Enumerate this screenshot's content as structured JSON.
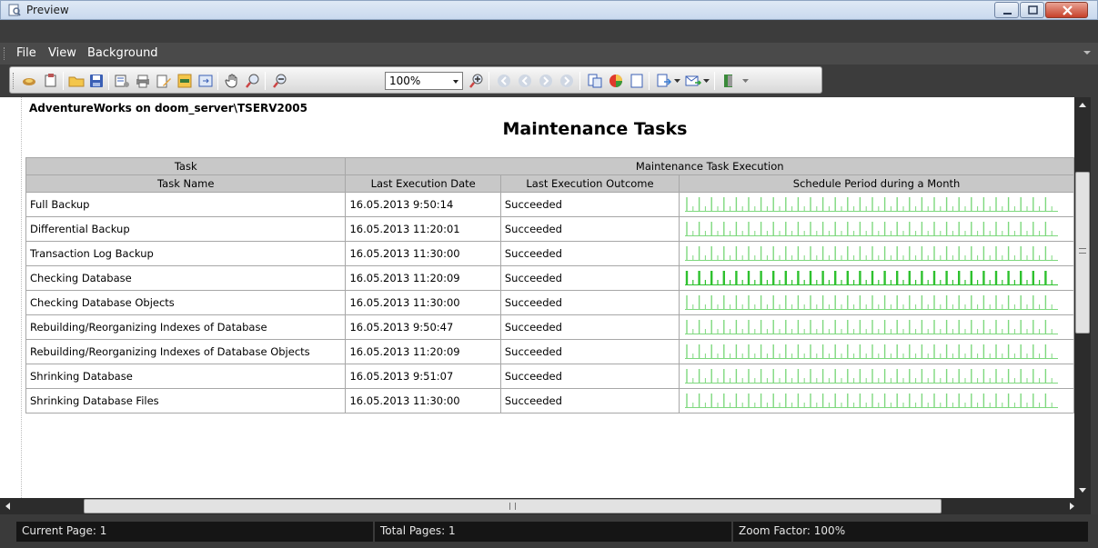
{
  "window": {
    "title": "Preview"
  },
  "menu": {
    "file": "File",
    "view": "View",
    "background": "Background"
  },
  "toolbar": {
    "zoom_value": "100%"
  },
  "report": {
    "server": "AdventureWorks on doom_server\\TSERV2005",
    "title": "Maintenance Tasks",
    "group_headers": {
      "task": "Task",
      "execution": "Maintenance Task Execution"
    },
    "columns": {
      "task_name": "Task Name",
      "last_date": "Last Execution Date",
      "last_outcome": "Last Execution Outcome",
      "schedule": "Schedule Period during a Month"
    },
    "rows": [
      {
        "name": "Full Backup",
        "date": "16.05.2013 9:50:14",
        "outcome": "Succeeded",
        "schedule_color": "#7ed87e"
      },
      {
        "name": "Differential Backup",
        "date": "16.05.2013 11:20:01",
        "outcome": "Succeeded",
        "schedule_color": "#7ed87e"
      },
      {
        "name": "Transaction Log Backup",
        "date": "16.05.2013 11:30:00",
        "outcome": "Succeeded",
        "schedule_color": "#7ed87e"
      },
      {
        "name": "Checking Database",
        "date": "16.05.2013 11:20:09",
        "outcome": "Succeeded",
        "schedule_color": "#2ec12e"
      },
      {
        "name": "Checking Database Objects",
        "date": "16.05.2013 11:30:00",
        "outcome": "Succeeded",
        "schedule_color": "#7ed87e"
      },
      {
        "name": "Rebuilding/Reorganizing Indexes of Database",
        "date": "16.05.2013 9:50:47",
        "outcome": "Succeeded",
        "schedule_color": "#7ed87e"
      },
      {
        "name": "Rebuilding/Reorganizing Indexes of Database Objects",
        "date": "16.05.2013 11:20:09",
        "outcome": "Succeeded",
        "schedule_color": "#7ed87e"
      },
      {
        "name": "Shrinking Database",
        "date": "16.05.2013 9:51:07",
        "outcome": "Succeeded",
        "schedule_color": "#7ed87e"
      },
      {
        "name": "Shrinking Database Files",
        "date": "16.05.2013 11:30:00",
        "outcome": "Succeeded",
        "schedule_color": "#7ed87e"
      }
    ]
  },
  "status": {
    "current_page": "Current Page: 1",
    "total_pages": "Total Pages: 1",
    "zoom_factor": "Zoom Factor: 100%"
  },
  "icons": {
    "toolbar": [
      "open-report-icon",
      "edit-report-icon",
      "open-folder-icon",
      "save-icon",
      "print-setup-icon",
      "print-icon",
      "edit-icon",
      "fit-page-icon",
      "fit-width-icon",
      "hand-tool-icon",
      "zoom-tool-icon",
      "zoom-out-icon",
      "zoom-in-icon",
      "first-page-icon",
      "prev-page-icon",
      "next-page-icon",
      "last-page-icon",
      "page-setup-icon",
      "background-icon",
      "one-page-icon",
      "export-icon",
      "send-icon",
      "exit-icon"
    ]
  }
}
